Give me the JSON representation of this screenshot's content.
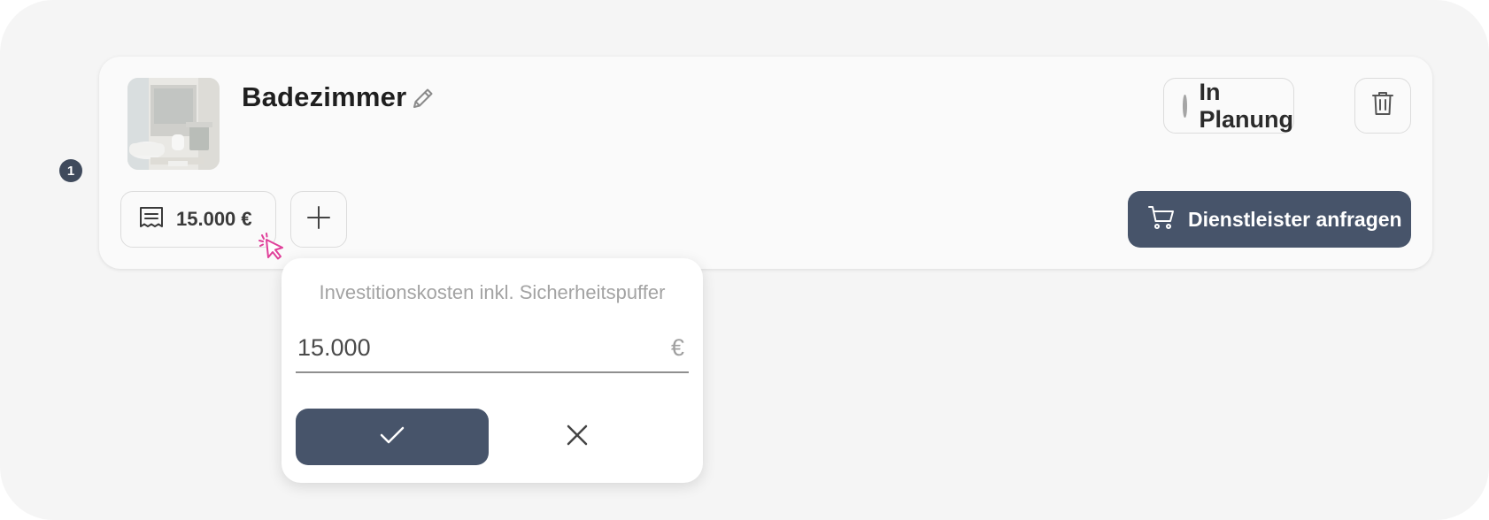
{
  "step_badge": "1",
  "room": {
    "title": "Badezimmer",
    "thumbnail_alt": "bathroom-photo",
    "edit_icon": "pencil-icon"
  },
  "status": {
    "label": "In Planung",
    "dot_color": "#a5a5a5"
  },
  "delete_icon": "trash-icon",
  "cost_button": {
    "icon": "receipt-icon",
    "label": "15.000 €"
  },
  "add_icon": "plus-icon",
  "request_button": {
    "icon": "cart-icon",
    "label": "Dienstleister anfragen"
  },
  "popover": {
    "label": "Investitionskosten inkl. Sicherheitspuffer",
    "value": "15.000",
    "unit": "€",
    "confirm_icon": "check-icon",
    "cancel_icon": "close-icon"
  },
  "colors": {
    "accent": "#47546a",
    "background": "#f5f5f5",
    "card": "#fafafa",
    "cursor": "#e0409a"
  }
}
